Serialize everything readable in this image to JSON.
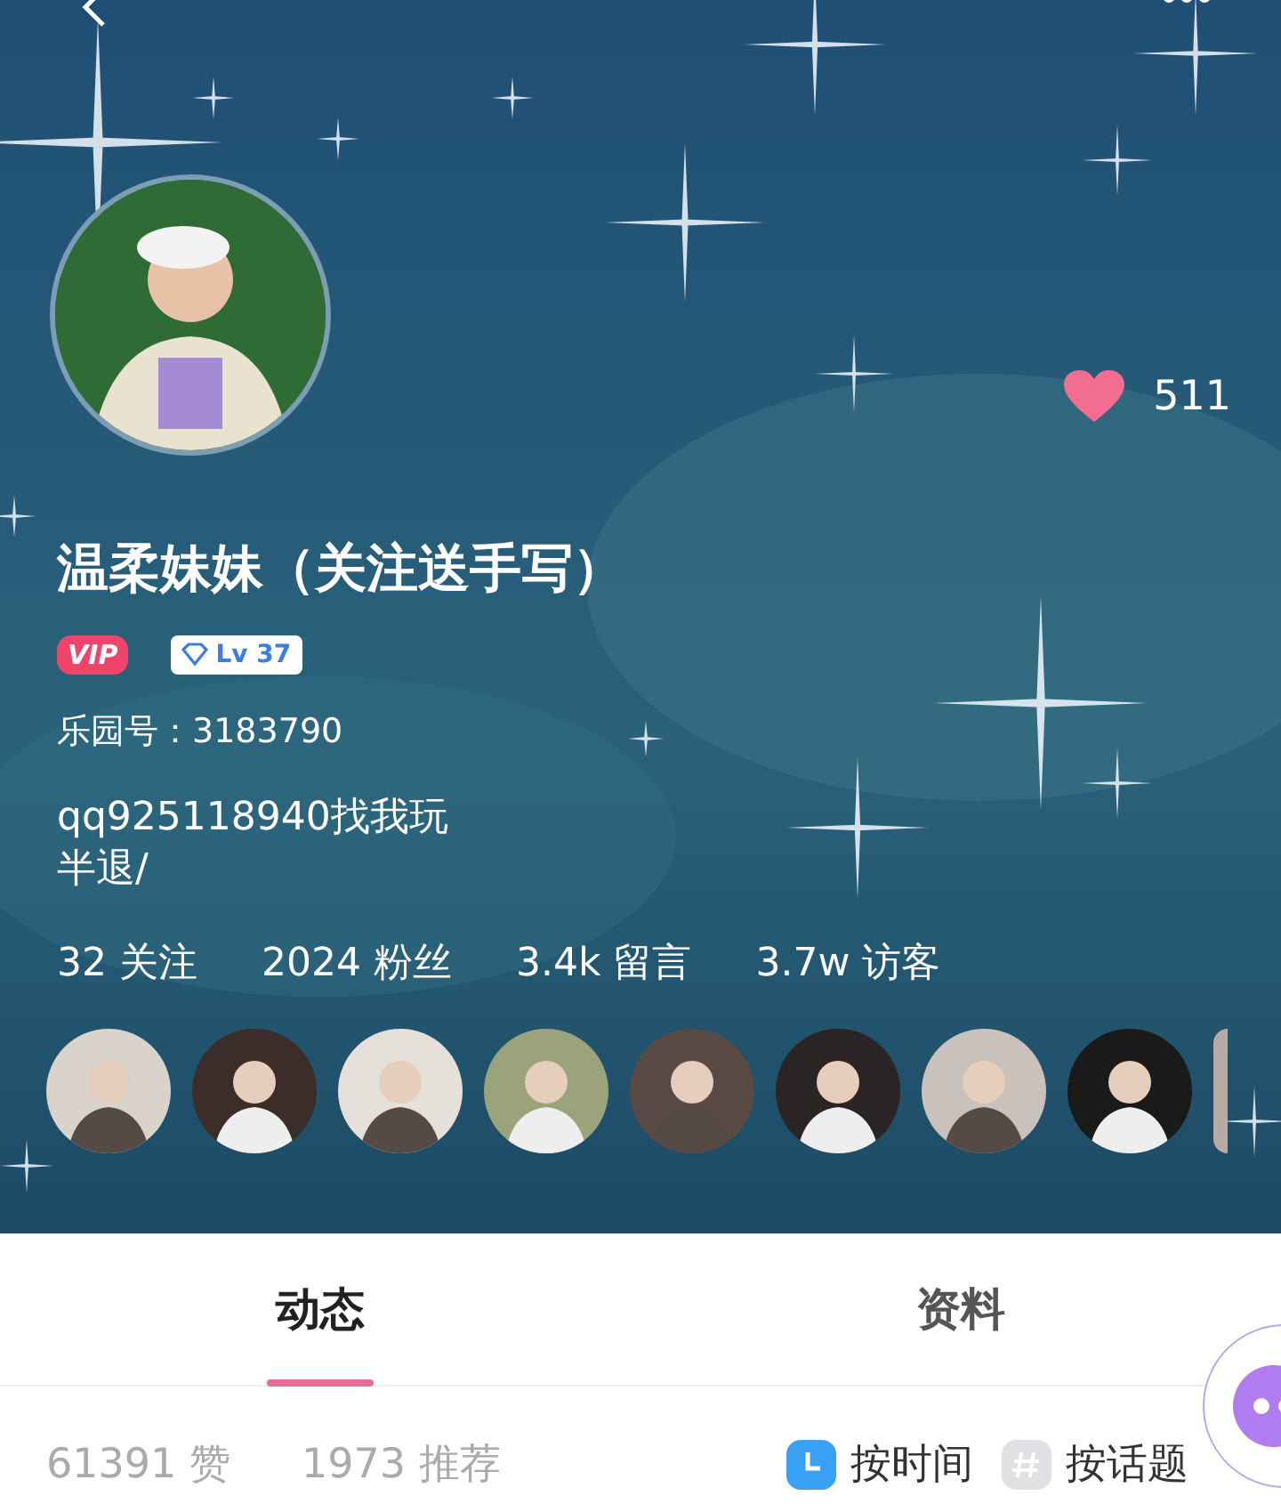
{
  "header": {
    "likes": "511",
    "name": "温柔妹妹（关注送手写）",
    "vip_badge": "VIP",
    "level_badge": "Lv 37",
    "id_line": "乐园号：3183790",
    "bio": [
      "qq925118940找我玩",
      "半退/"
    ],
    "stats": [
      "32 关注",
      "2024 粉丝",
      "3.4k 留言",
      "3.7w 访客"
    ]
  },
  "tabs": [
    {
      "label": "动态",
      "selected": true
    },
    {
      "label": "资料",
      "selected": false
    }
  ],
  "counts": [
    "61391 赞",
    "1973 推荐"
  ],
  "sort_options": [
    {
      "label": "按时间",
      "selected": true
    },
    {
      "label": "按话题",
      "selected": false
    }
  ]
}
